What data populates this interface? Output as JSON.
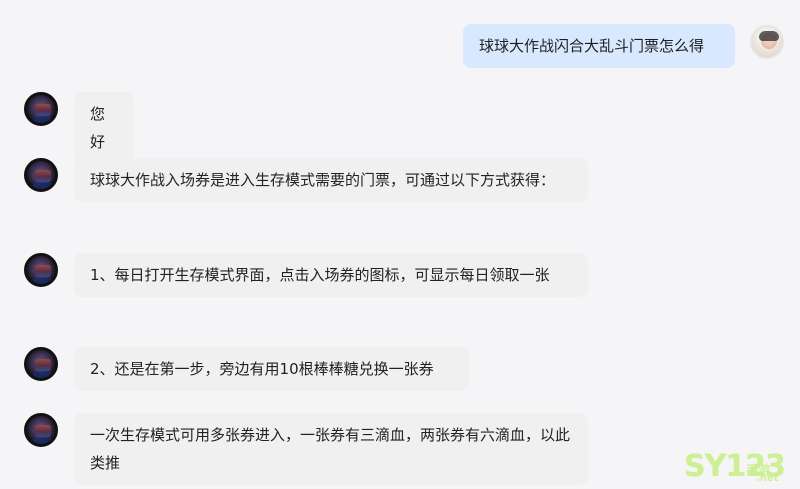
{
  "chat": {
    "top_clipped_text": "",
    "messages": [
      {
        "role": "user",
        "text": "球球大作战闪合大乱斗门票怎么得"
      },
      {
        "role": "assistant",
        "text": "您好"
      },
      {
        "role": "assistant",
        "text": "球球大作战入场券是进入生存模式需要的门票，可通过以下方式获得："
      },
      {
        "role": "assistant",
        "text": "1、每日打开生存模式界面，点击入场券的图标，可显示每日领取一张"
      },
      {
        "role": "assistant",
        "text": "2、还是在第一步，旁边有用10根棒棒糖兑换一张券"
      },
      {
        "role": "assistant",
        "text": "一次生存模式可用多张券进入，一张券有三滴血，两张券有六滴血，以此类推"
      }
    ]
  },
  "icons": {
    "user_avatar": "user-avatar-icon",
    "bot_avatar": "bot-avatar-icon"
  },
  "watermark": {
    "brand": "SY123",
    "sub": "手游",
    "domain": ".net"
  },
  "colors": {
    "background": "#f5f5f7",
    "bot_bubble": "#f0f0f0",
    "user_bubble": "#d7e8ff",
    "watermark": "#c9f08a"
  }
}
